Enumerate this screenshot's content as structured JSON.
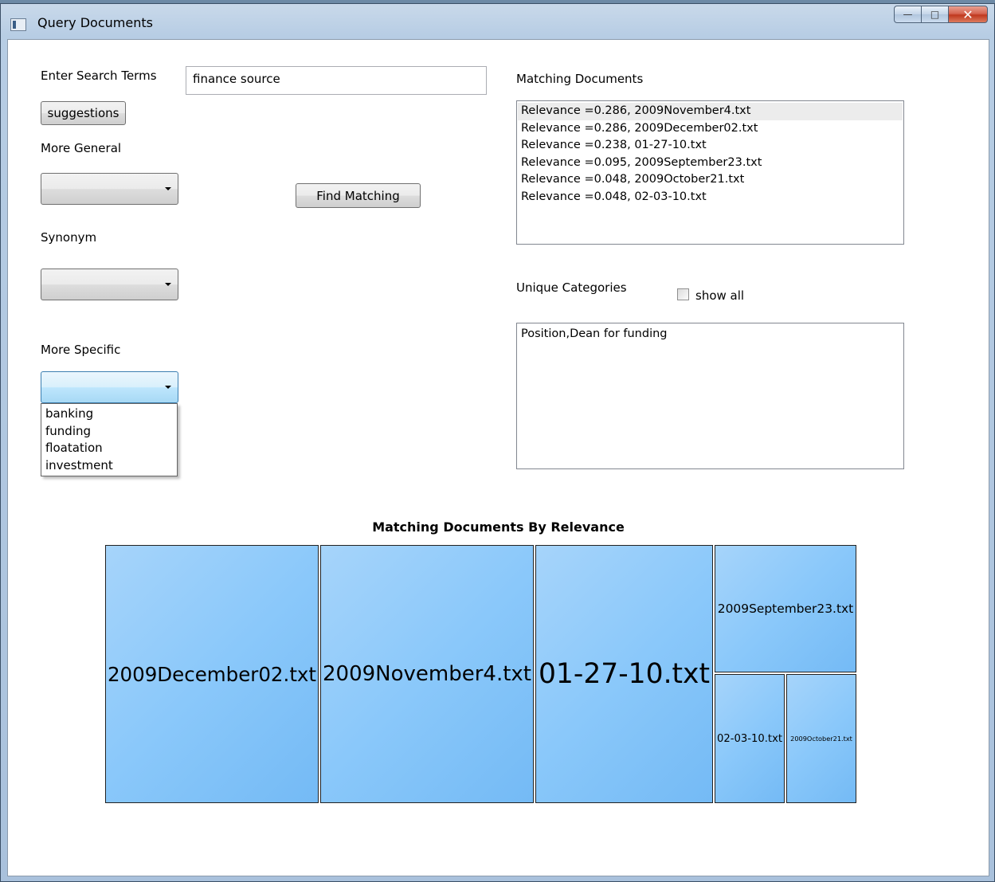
{
  "window": {
    "title": "Query Documents"
  },
  "search": {
    "label": "Enter Search Terms",
    "value": "finance source"
  },
  "buttons": {
    "suggestions": "suggestions",
    "find_matching": "Find Matching"
  },
  "more_general": {
    "label": "More General",
    "selected": ""
  },
  "synonym": {
    "label": "Synonym",
    "selected": ""
  },
  "more_specific": {
    "label": "More Specific",
    "selected": "",
    "options": [
      "banking",
      "funding",
      "floatation",
      "investment"
    ]
  },
  "matching_documents": {
    "label": "Matching Documents",
    "items": [
      "Relevance =0.286, 2009November4.txt",
      "Relevance =0.286, 2009December02.txt",
      "Relevance =0.238, 01-27-10.txt",
      "Relevance =0.095, 2009September23.txt",
      "Relevance =0.048, 2009October21.txt",
      "Relevance =0.048, 02-03-10.txt"
    ]
  },
  "unique_categories": {
    "label": "Unique Categories",
    "show_all_label": "show all",
    "show_all_checked": false,
    "items": [
      "Position,Dean for funding"
    ]
  },
  "chart_data": {
    "type": "treemap",
    "title": "Matching Documents By Relevance",
    "items": [
      {
        "name": "2009December02.txt",
        "value": 0.286
      },
      {
        "name": "2009November4.txt",
        "value": 0.286
      },
      {
        "name": "01-27-10.txt",
        "value": 0.238
      },
      {
        "name": "2009September23.txt",
        "value": 0.095
      },
      {
        "name": "02-03-10.txt",
        "value": 0.048
      },
      {
        "name": "2009October21.txt",
        "value": 0.048
      }
    ]
  }
}
